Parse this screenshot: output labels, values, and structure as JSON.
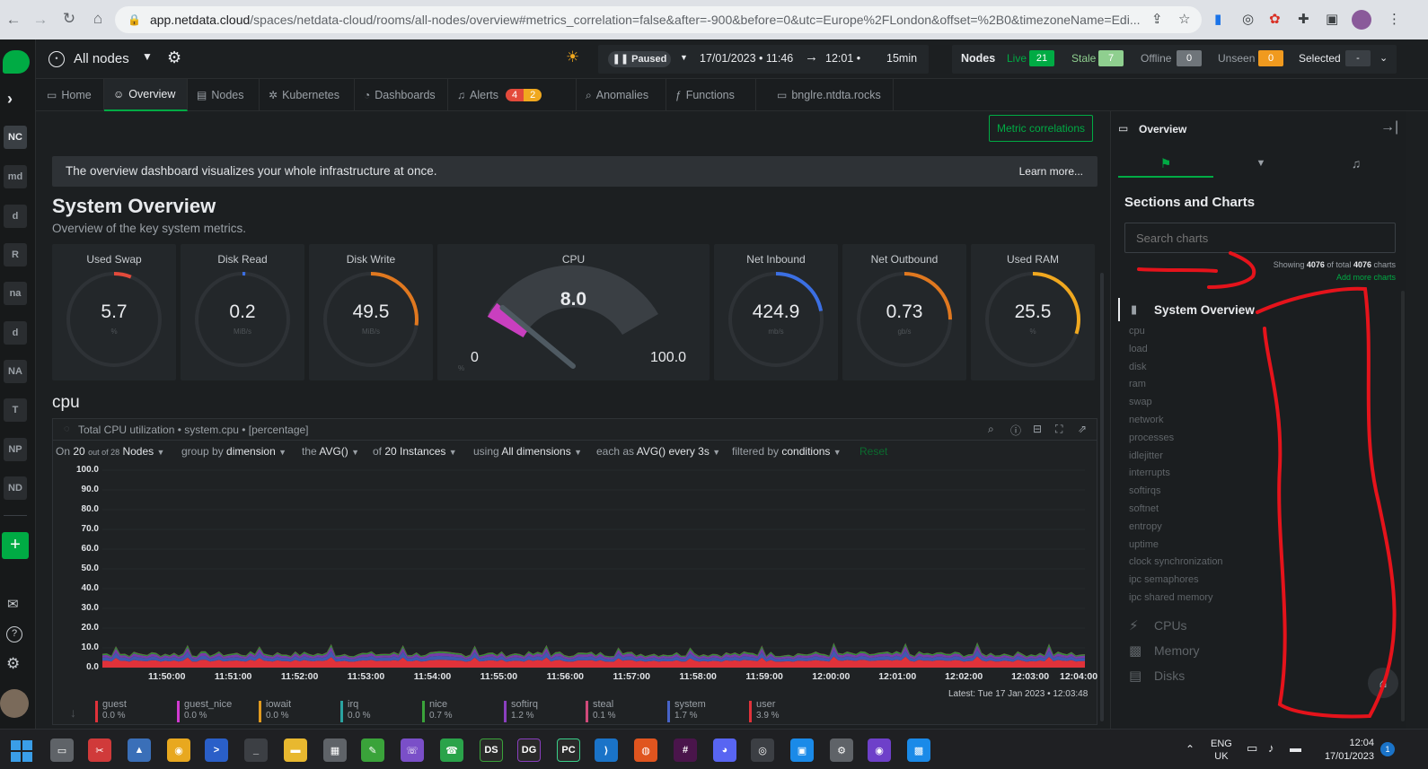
{
  "browser": {
    "url_host": "app.netdata.cloud",
    "url_path": "/spaces/netdata-cloud/rooms/all-nodes/overview#metrics_correlation=false&after=-900&before=0&utc=Europe%2FLondon&offset=%2B0&timezoneName=Edi..."
  },
  "rail": {
    "items": [
      "NC",
      "md",
      "d",
      "R",
      "na",
      "d",
      "NA",
      "T",
      "NP",
      "ND"
    ],
    "add": "+"
  },
  "header": {
    "room": "All nodes",
    "paused": "Paused",
    "time_range": "17/01/2023 • 11:46",
    "time_end": "12:01 •",
    "duration": "15min",
    "nodes_label": "Nodes",
    "live_label": "Live",
    "live_count": "21",
    "stale_label": "Stale",
    "stale_count": "7",
    "offline_label": "Offline",
    "offline_count": "0",
    "unseen_label": "Unseen",
    "unseen_count": "0",
    "selected_label": "Selected",
    "selected_value": "-"
  },
  "tabs": [
    {
      "label": "Home",
      "icon": "▭"
    },
    {
      "label": "Overview",
      "icon": "☺"
    },
    {
      "label": "Nodes",
      "icon": "▤"
    },
    {
      "label": "Kubernetes",
      "icon": "✲"
    },
    {
      "label": "Dashboards",
      "icon": "◔"
    },
    {
      "label": "Alerts",
      "icon": "♫"
    },
    {
      "label": "Anomalies",
      "icon": "⌕"
    },
    {
      "label": "Functions",
      "icon": "ƒ"
    },
    {
      "label": "bnglre.ntdta.rocks",
      "icon": "▭"
    }
  ],
  "alerts": {
    "critical": "4",
    "warning": "2"
  },
  "banner": {
    "text": "The overview dashboard visualizes your whole infrastructure at once.",
    "link": "Learn more..."
  },
  "metric_correlations": "Metric correlations",
  "section": {
    "title": "System Overview",
    "subtitle": "Overview of the key system metrics."
  },
  "gauges": [
    {
      "title": "Used Swap",
      "value": "5.7",
      "unit": "%",
      "fraction": 0.06,
      "color": "#e34a3b"
    },
    {
      "title": "Disk Read",
      "value": "0.2",
      "unit": "MiB/s",
      "fraction": 0.01,
      "color": "#3b6fe3"
    },
    {
      "title": "Disk Write",
      "value": "49.5",
      "unit": "MiB/s",
      "fraction": 0.27,
      "color": "#e0781f"
    },
    {
      "title": "Net Inbound",
      "value": "424.9",
      "unit": "mb/s",
      "fraction": 0.22,
      "color": "#3b6fe3"
    },
    {
      "title": "Net Outbound",
      "value": "0.73",
      "unit": "gb/s",
      "fraction": 0.25,
      "color": "#e0781f"
    },
    {
      "title": "Used RAM",
      "value": "25.5",
      "unit": "%",
      "fraction": 0.3,
      "color": "#f0a81f"
    }
  ],
  "cpu_gauge": {
    "title": "CPU",
    "value": "8.0",
    "min": "0",
    "max": "100.0",
    "unit": "%",
    "fraction": 0.08
  },
  "cpu_section": "cpu",
  "chart_title": "Total CPU utilization • system.cpu • [percentage]",
  "controls": {
    "on": "On",
    "nodes_n": "20",
    "out_of": "out of 28",
    "nodes": "Nodes",
    "group_by": "group by",
    "dimension": "dimension",
    "the": "the",
    "avg": "AVG()",
    "of": "of",
    "instances": "20 Instances",
    "using": "using",
    "all_dims": "All dimensions",
    "each_as": "each as",
    "avg2": "AVG() every 3s",
    "filtered_by": "filtered by",
    "conditions": "conditions",
    "reset": "Reset"
  },
  "latest": "Latest: Tue 17 Jan 2023 • 12:03:48",
  "chart_data": {
    "type": "area",
    "title": "Total CPU utilization • system.cpu • [percentage]",
    "ylim": [
      0,
      100
    ],
    "yticks": [
      "100.0",
      "90.0",
      "80.0",
      "70.0",
      "60.0",
      "50.0",
      "40.0",
      "30.0",
      "20.0",
      "10.0",
      "0.0"
    ],
    "xticks": [
      "11:50:00",
      "11:51:00",
      "11:52:00",
      "11:53:00",
      "11:54:00",
      "11:55:00",
      "11:56:00",
      "11:57:00",
      "11:58:00",
      "11:59:00",
      "12:00:00",
      "12:01:00",
      "12:02:00",
      "12:03:00",
      "12:04:00"
    ],
    "series": [
      {
        "name": "user",
        "color": "#e0323a",
        "value": 3.9
      },
      {
        "name": "system",
        "color": "#4763c8",
        "value": 1.7
      },
      {
        "name": "softirq",
        "color": "#8a3fbf",
        "value": 1.2
      },
      {
        "name": "nice",
        "color": "#3aa33a",
        "value": 0.7
      },
      {
        "name": "steal",
        "color": "#d04a7a",
        "value": 0.1
      }
    ]
  },
  "legend": [
    {
      "name": "guest",
      "value": "0.0 %",
      "color": "#e0323a"
    },
    {
      "name": "guest_nice",
      "value": "0.0 %",
      "color": "#d03ad0"
    },
    {
      "name": "iowait",
      "value": "0.0 %",
      "color": "#e09a1f"
    },
    {
      "name": "irq",
      "value": "0.0 %",
      "color": "#2aa3a0"
    },
    {
      "name": "nice",
      "value": "0.7 %",
      "color": "#3aa33a"
    },
    {
      "name": "softirq",
      "value": "1.2 %",
      "color": "#8a3fbf"
    },
    {
      "name": "steal",
      "value": "0.1 %",
      "color": "#d04a7a"
    },
    {
      "name": "system",
      "value": "1.7 %",
      "color": "#4763c8"
    },
    {
      "name": "user",
      "value": "3.9 %",
      "color": "#e0323a"
    }
  ],
  "sidebar": {
    "title": "Overview",
    "sections_title": "Sections and Charts",
    "search_placeholder": "Search charts",
    "showing": "Showing",
    "shown": "4076",
    "of_total": "of total",
    "total": "4076",
    "charts": "charts",
    "add_more": "Add more charts",
    "group": "System Overview",
    "items": [
      "cpu",
      "load",
      "disk",
      "ram",
      "swap",
      "network",
      "processes",
      "idlejitter",
      "interrupts",
      "softirqs",
      "softnet",
      "entropy",
      "uptime",
      "clock synchronization",
      "ipc semaphores",
      "ipc shared memory"
    ],
    "groups": [
      "CPUs",
      "Memory",
      "Disks"
    ]
  },
  "taskbar": {
    "lang": "ENG",
    "region": "UK",
    "time": "12:04",
    "date": "17/01/2023"
  }
}
